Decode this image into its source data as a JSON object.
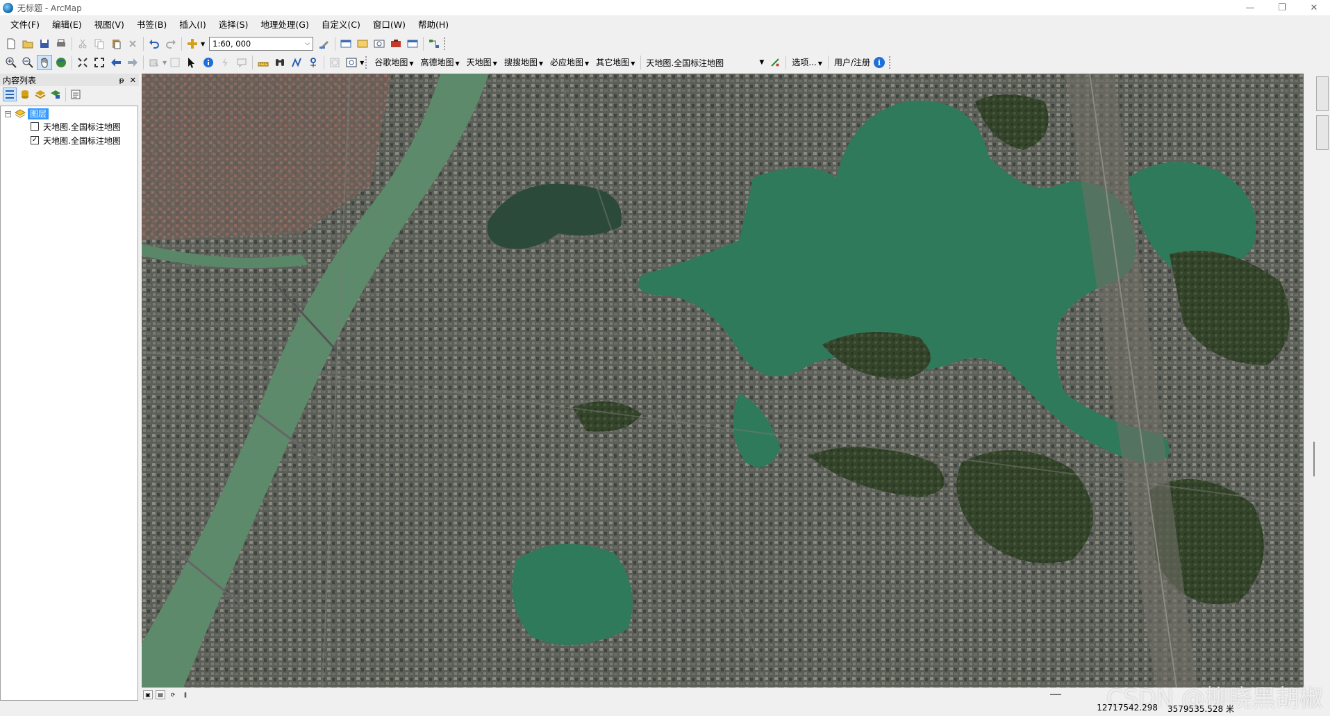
{
  "window": {
    "title": "无标题 - ArcMap",
    "minimize": "—",
    "maximize": "❐",
    "close": "✕"
  },
  "menu": [
    "文件(F)",
    "编辑(E)",
    "视图(V)",
    "书签(B)",
    "插入(I)",
    "选择(S)",
    "地理处理(G)",
    "自定义(C)",
    "窗口(W)",
    "帮助(H)"
  ],
  "toolbar": {
    "scale": "1:60, 000",
    "map_menus": [
      "谷歌地图",
      "高德地图",
      "天地图",
      "搜搜地图",
      "必应地图",
      "其它地图"
    ],
    "layer_select": "天地图.全国标注地图",
    "options": "选项...",
    "user_register": "用户/注册",
    "info_icon": "i"
  },
  "toc": {
    "title": "内容列表",
    "pin": "ᵽ",
    "close": "✕",
    "root_label": "图层",
    "layers": [
      {
        "name": "天地图.全国标注地图",
        "checked": false
      },
      {
        "name": "天地图.全国标注地图",
        "checked": true
      }
    ]
  },
  "status": {
    "x": "12717542.298",
    "y": "3579535.528 米"
  },
  "watermark": "CSDN @柳晓黑胡椒",
  "colors": {
    "river": "#5d8a6a",
    "lake": "#2f7a5a",
    "urban": "#5f625c",
    "vegetation": "#3c4a2f",
    "selection": "#3399ff"
  }
}
